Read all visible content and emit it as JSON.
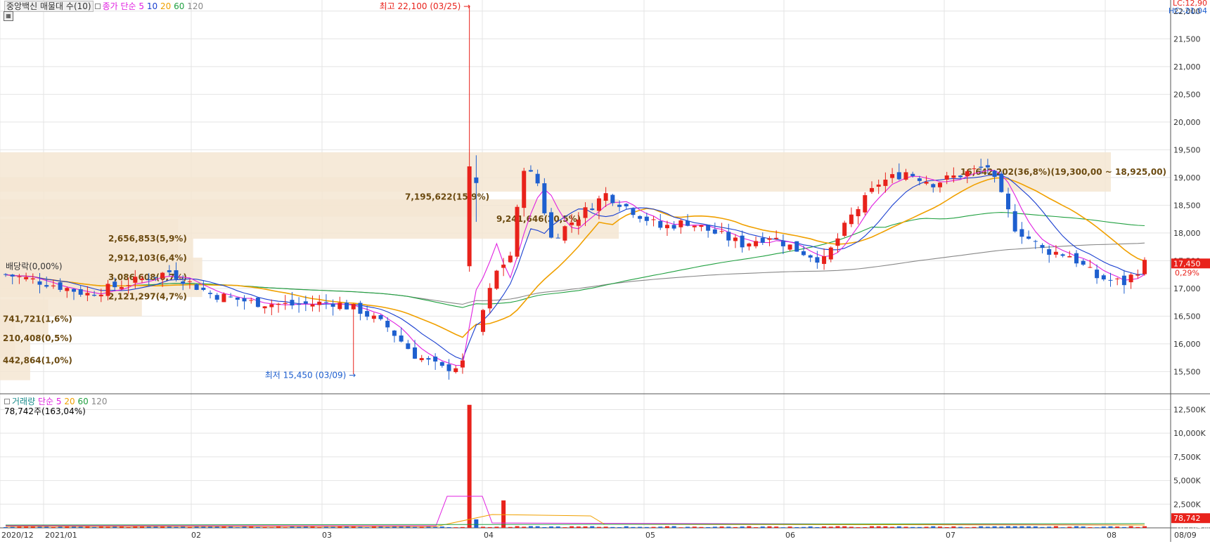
{
  "legend_price": {
    "name": "중앙백신 매물대 수(10)",
    "ma_title": "종가 단순",
    "ma_periods": [
      "5",
      "10",
      "20",
      "60",
      "120"
    ]
  },
  "legend_volume": {
    "name": "거래량",
    "ma_title": "단순",
    "ma_periods": [
      "5",
      "20",
      "60",
      "120"
    ],
    "current": "78,742주(163,04%)"
  },
  "corner_labels": {
    "lc": "LC:12,90",
    "hc": "HC:-21,04"
  },
  "colors": {
    "up": "#e8221b",
    "down": "#1e5fcf",
    "ma5": "#e020e0",
    "ma10": "#1a3fd0",
    "ma20": "#f0a000",
    "ma60": "#20a040",
    "ma120": "#888888",
    "profile": "#f5e6d2"
  },
  "chart_data": {
    "type": "candlestick",
    "title": "중앙백신",
    "price_axis": {
      "min": 15100,
      "max": 22200,
      "ticks": [
        "22,000",
        "21,500",
        "21,000",
        "20,500",
        "20,000",
        "19,500",
        "19,000",
        "18,500",
        "18,000",
        "17,500",
        "17,000",
        "16,500",
        "16,000",
        "15,500"
      ]
    },
    "volume_axis": {
      "min": 0,
      "max": 13500,
      "ticks": [
        "12,500K",
        "10,000K",
        "7,500K",
        "5,000K",
        "2,500K"
      ]
    },
    "x_axis_labels": [
      "2020/12",
      "2021/01",
      "02",
      "03",
      "04",
      "05",
      "06",
      "07",
      "08",
      "08/09"
    ],
    "ohlc_keypoints": [
      {
        "date": "2020/12",
        "close": 17250
      },
      {
        "date": "2021/01/04",
        "close": 17150
      },
      {
        "date": "2021/02",
        "close": 16800
      },
      {
        "date": "2021/03/09",
        "low": 15450
      },
      {
        "date": "2021/03/25",
        "high": 22100,
        "close": 19200
      },
      {
        "date": "2021/04",
        "close": 17800
      },
      {
        "date": "2021/04/15",
        "close": 19000
      },
      {
        "date": "2021/05",
        "close": 17900
      },
      {
        "date": "2021/06",
        "close": 17500
      },
      {
        "date": "2021/06/10",
        "close": 19000
      },
      {
        "date": "2021/07/01",
        "close": 19300
      },
      {
        "date": "2021/07/15",
        "close": 17800
      },
      {
        "date": "2021/08/02",
        "close": 17050
      },
      {
        "date": "2021/08/09",
        "close": 17450
      }
    ],
    "volume_spikes": [
      {
        "date": "2021/03/25",
        "volume_k": 13000
      },
      {
        "date": "2021/04/05",
        "volume_k": 2900
      }
    ],
    "volume_profile": [
      {
        "label": "442,864(1,0%)",
        "price": 15700,
        "share": 1.0
      },
      {
        "label": "210,408(0,5%)",
        "price": 16100,
        "share": 0.5
      },
      {
        "label": "741,721(1,6%)",
        "price": 16450,
        "share": 1.6
      },
      {
        "label": "2,121,297(4,7%)",
        "price": 16850,
        "share": 4.7
      },
      {
        "label": "3,086,608(6,7%)",
        "price": 17200,
        "share": 6.7
      },
      {
        "label": "2,912,103(6,4%)",
        "price": 17550,
        "share": 6.4
      },
      {
        "label": "2,656,853(5,9%)",
        "price": 17900,
        "share": 5.9
      },
      {
        "label": "9,241,646(20,5%)",
        "price": 18250,
        "share": 20.5
      },
      {
        "label": "7,195,622(15,9%)",
        "price": 18650,
        "share": 15.9
      },
      {
        "label": "16,642,202(36,8%)(19,300,00 ~ 18,925,00)",
        "price": 19100,
        "share": 36.8
      }
    ],
    "annotations": {
      "high": "최고 22,100 (03/25)",
      "low": "최저 15,450 (03/09)",
      "dividend": "배당락(0,00%)"
    },
    "current_price": {
      "value": "17,450",
      "change": "0,29%"
    },
    "current_volume": {
      "value": "78,742",
      "change": "163,04%"
    }
  }
}
